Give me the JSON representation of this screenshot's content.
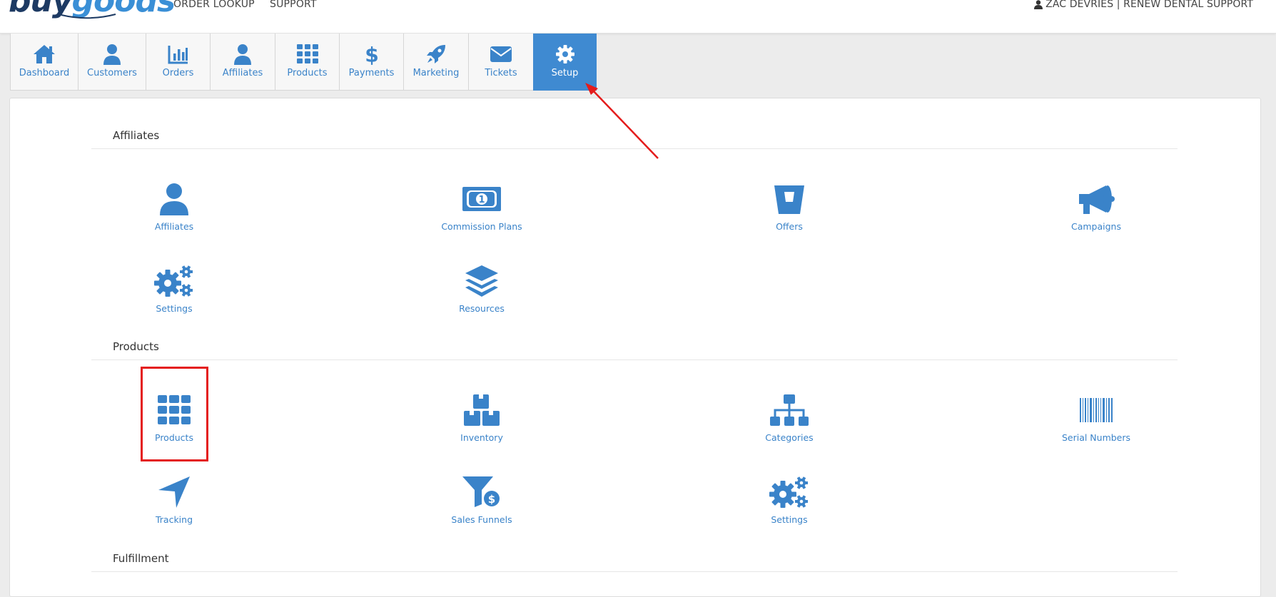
{
  "header": {
    "logo_buy": "buy",
    "logo_goods": "goods",
    "order_lookup": "ORDER LOOKUP",
    "support": "SUPPORT",
    "user": "ZAC DEVRIES | RENEW DENTAL SUPPORT"
  },
  "nav": {
    "tabs": [
      {
        "label": "Dashboard",
        "icon": "home-icon"
      },
      {
        "label": "Customers",
        "icon": "user-icon"
      },
      {
        "label": "Orders",
        "icon": "bar-chart-icon"
      },
      {
        "label": "Affiliates",
        "icon": "user-icon"
      },
      {
        "label": "Products",
        "icon": "grid-icon"
      },
      {
        "label": "Payments",
        "icon": "dollar-icon"
      },
      {
        "label": "Marketing",
        "icon": "rocket-icon"
      },
      {
        "label": "Tickets",
        "icon": "envelope-icon"
      },
      {
        "label": "Setup",
        "icon": "gear-icon"
      }
    ],
    "active": "Setup"
  },
  "sections": {
    "affiliates": {
      "title": "Affiliates",
      "items": [
        {
          "label": "Affiliates",
          "icon": "user-icon"
        },
        {
          "label": "Commission Plans",
          "icon": "money-bill-icon"
        },
        {
          "label": "Offers",
          "icon": "bucket-icon"
        },
        {
          "label": "Campaigns",
          "icon": "megaphone-icon"
        },
        {
          "label": "Settings",
          "icon": "gears-icon"
        },
        {
          "label": "Resources",
          "icon": "layers-icon"
        }
      ]
    },
    "products": {
      "title": "Products",
      "items": [
        {
          "label": "Products",
          "icon": "grid-icon"
        },
        {
          "label": "Inventory",
          "icon": "boxes-icon"
        },
        {
          "label": "Categories",
          "icon": "sitemap-icon"
        },
        {
          "label": "Serial Numbers",
          "icon": "barcode-icon"
        },
        {
          "label": "Tracking",
          "icon": "location-arrow-icon"
        },
        {
          "label": "Sales Funnels",
          "icon": "funnel-dollar-icon"
        },
        {
          "label": "Settings",
          "icon": "gears-icon"
        }
      ]
    },
    "fulfillment": {
      "title": "Fulfillment"
    }
  },
  "colors": {
    "accent": "#3a83c9",
    "active_tab": "#3f8ad1",
    "annotation": "#e41c1c"
  }
}
